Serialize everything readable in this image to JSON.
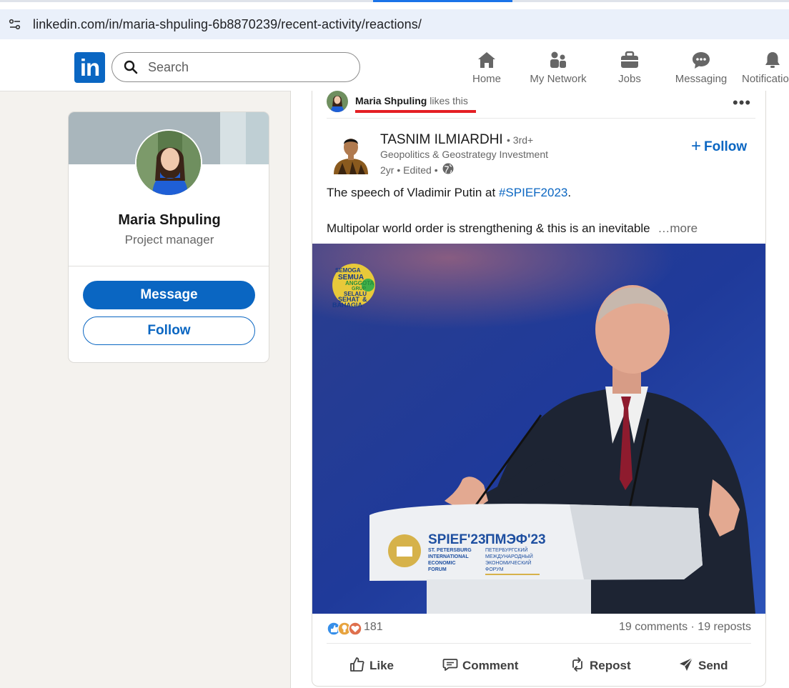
{
  "browser": {
    "url_host": "linkedin.com",
    "url_path": "/in/maria-shpuling-6b8870239/recent-activity/reactions/"
  },
  "nav": {
    "logo": "in",
    "search_placeholder": "Search",
    "items": [
      {
        "label": "Home",
        "icon": "home-icon"
      },
      {
        "label": "My Network",
        "icon": "network-icon"
      },
      {
        "label": "Jobs",
        "icon": "briefcase-icon"
      },
      {
        "label": "Messaging",
        "icon": "messaging-icon"
      },
      {
        "label": "Notificatio",
        "icon": "bell-icon"
      }
    ]
  },
  "profile": {
    "name": "Maria Shpuling",
    "title": "Project manager",
    "message_label": "Message",
    "follow_label": "Follow"
  },
  "post": {
    "liker_name": "Maria Shpuling",
    "liker_action": "likes this",
    "author_name": "TASNIM ILMIARDHI",
    "author_degree": "• 3rd+",
    "author_headline": "Geopolitics & Geostrategy Investment",
    "author_time": "2yr • Edited •",
    "follow_label": "Follow",
    "text_line1_prefix": "The speech of Vladimir Putin at ",
    "text_line1_tag": "#SPIEF2023",
    "text_line1_suffix": ".",
    "text_line2": "Multipolar world order is strengthening & this is an inevitable",
    "more_label": "…more",
    "image_overlay": {
      "badge": [
        "SEMOGA",
        "SEMUA",
        "ANGGOTA",
        "GRUP",
        "SELALU",
        "SEHAT",
        "&",
        "BAHAGIA"
      ],
      "podium_en": "SPIEF'23",
      "podium_ru": "ПМЭФ'23",
      "podium_en_sub": [
        "ST. PETERSBURG",
        "INTERNATIONAL",
        "ECONOMIC",
        "FORUM"
      ],
      "podium_ru_sub": [
        "ПЕТЕРБУРГСКИЙ",
        "МЕЖДУНАРОДНЫЙ",
        "ЭКОНОМИЧЕСКИЙ",
        "ФОРУМ"
      ]
    },
    "reaction_count": "181",
    "comments_reposts": "19 comments · 19 reposts",
    "actions": [
      {
        "label": "Like",
        "icon": "thumbs-up-icon"
      },
      {
        "label": "Comment",
        "icon": "comment-icon"
      },
      {
        "label": "Repost",
        "icon": "repost-icon"
      },
      {
        "label": "Send",
        "icon": "send-icon"
      }
    ]
  },
  "colors": {
    "brand": "#0a66c2",
    "highlight": "#e51f24"
  }
}
